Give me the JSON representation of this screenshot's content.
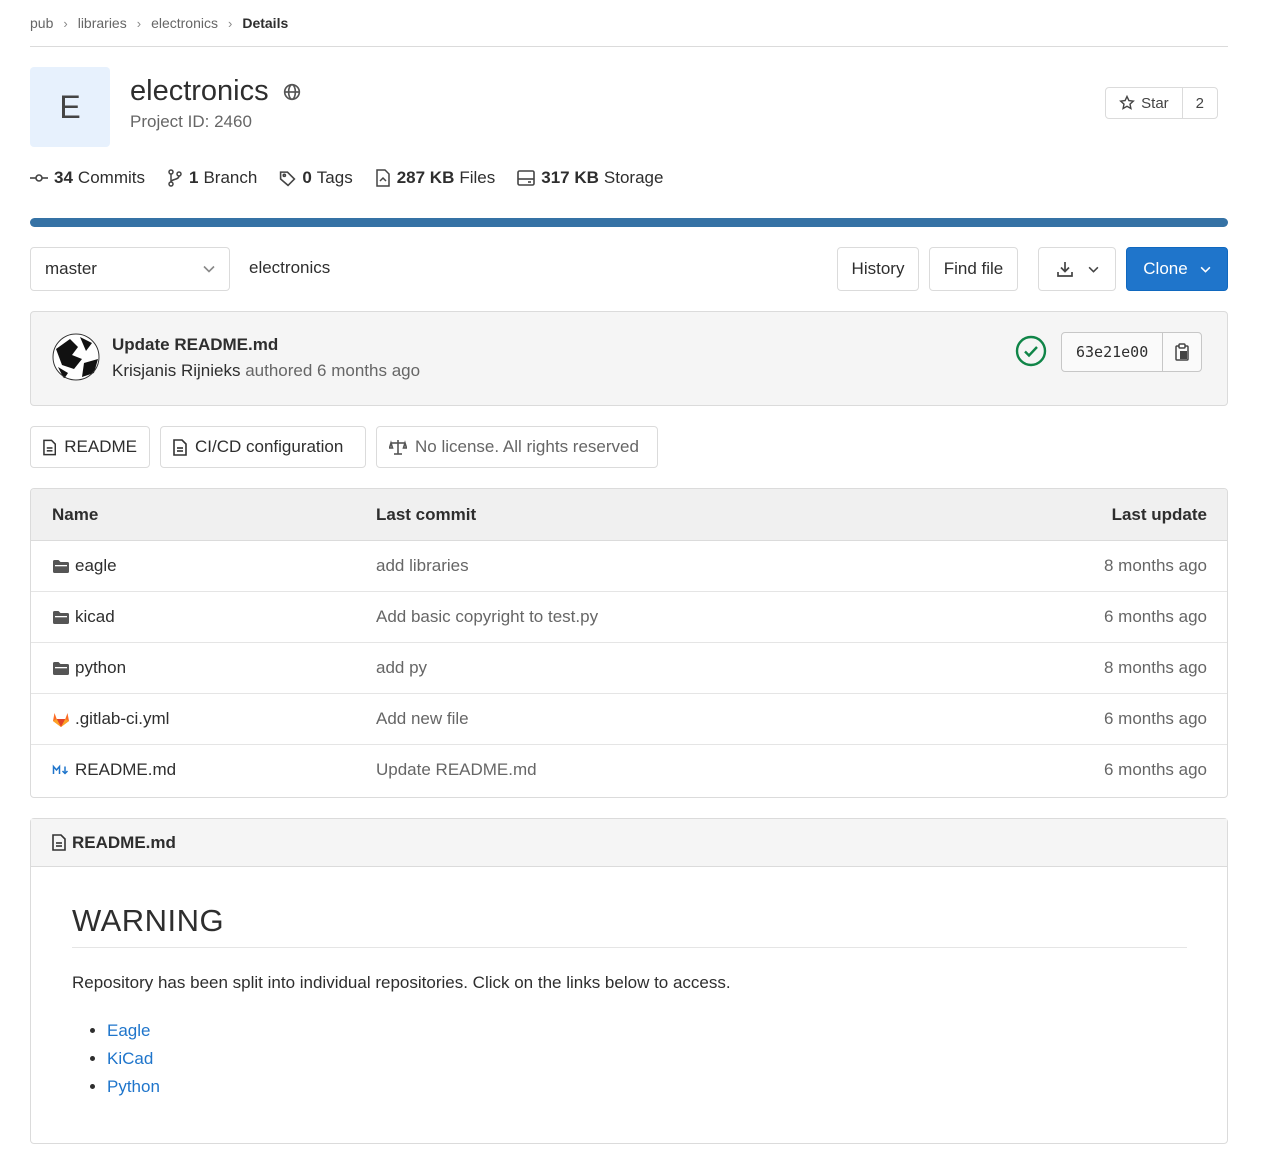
{
  "breadcrumb": [
    "pub",
    "libraries",
    "electronics",
    "Details"
  ],
  "project": {
    "avatar_letter": "E",
    "name": "electronics",
    "id_text": "Project ID: 2460",
    "star_label": "Star",
    "star_count": "2"
  },
  "stats": [
    {
      "icon": "commit-icon",
      "value": "34",
      "label": "Commits"
    },
    {
      "icon": "branch-icon",
      "value": "1",
      "label": "Branch"
    },
    {
      "icon": "tag-icon",
      "value": "0",
      "label": "Tags"
    },
    {
      "icon": "file-icon",
      "value": "287 KB",
      "label": "Files"
    },
    {
      "icon": "storage-icon",
      "value": "317 KB",
      "label": "Storage"
    }
  ],
  "colors": {
    "language_bar": "#3572a5",
    "primary": "#1f75cb",
    "success": "#108548"
  },
  "toolbar": {
    "branch": "master",
    "path": "electronics",
    "history": "History",
    "find_file": "Find file",
    "clone": "Clone"
  },
  "commit": {
    "title": "Update README.md",
    "author": "Krisjanis Rijnieks",
    "meta": "authored 6 months ago",
    "sha": "63e21e00"
  },
  "repo_buttons": {
    "readme": "README",
    "cicd": "CI/CD configuration",
    "license": "No license. All rights reserved"
  },
  "table": {
    "headers": {
      "name": "Name",
      "last_commit": "Last commit",
      "last_update": "Last update"
    },
    "rows": [
      {
        "icon": "folder-icon",
        "name": "eagle",
        "commit": "add libraries",
        "date": "8 months ago"
      },
      {
        "icon": "folder-icon",
        "name": "kicad",
        "commit": "Add basic copyright to test.py",
        "date": "6 months ago"
      },
      {
        "icon": "folder-icon",
        "name": "python",
        "commit": "add py",
        "date": "8 months ago"
      },
      {
        "icon": "gitlab-icon",
        "name": ".gitlab-ci.yml",
        "commit": "Add new file",
        "date": "6 months ago"
      },
      {
        "icon": "markdown-icon",
        "name": "README.md",
        "commit": "Update README.md",
        "date": "6 months ago"
      }
    ]
  },
  "readme": {
    "filename": "README.md",
    "heading": "WARNING",
    "paragraph": "Repository has been split into individual repositories. Click on the links below to access.",
    "links": [
      "Eagle",
      "KiCad",
      "Python"
    ]
  }
}
